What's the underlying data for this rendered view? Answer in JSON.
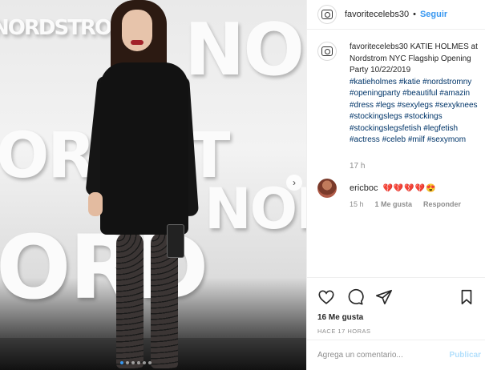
{
  "post": {
    "username": "favoritecelebs30",
    "header_separator": "•",
    "follow_label": "Seguir"
  },
  "caption": {
    "username": "favoritecelebs30",
    "lines": [
      "KATIE HOLMES at",
      "Nordstrom NYC Flagship Opening",
      "Party 10/22/2019",
      "#katieholmes #katie #nordstromny",
      "#openingparty #beautiful #amazin",
      "#dress #legs #sexylegs #sexyknees",
      "#stockingslegs #stockings",
      "#stockingslegsfetish #legfetish",
      "#actress #celeb #milf #sexymom"
    ],
    "time": "17 h"
  },
  "comment": {
    "username": "ericboc",
    "text": "💔💔💔💔😍",
    "time": "15 h",
    "likes": "1 Me gusta",
    "reply_label": "Responder"
  },
  "stats": {
    "likes": "16 Me gusta",
    "posted_ago": "HACE 17 HORAS"
  },
  "compose": {
    "placeholder": "Agrega un comentario...",
    "post_label": "Publicar"
  },
  "photo": {
    "background_words": [
      "NORDSTROM",
      "NO",
      "ORDST",
      "NOR",
      "ORD"
    ]
  },
  "carousel": {
    "total": 6,
    "active_index": 0
  },
  "colors": {
    "link_blue": "#3897f0",
    "hashtag_blue": "#003569",
    "muted_gray": "#8e8e8e",
    "text_dark": "#262626"
  }
}
